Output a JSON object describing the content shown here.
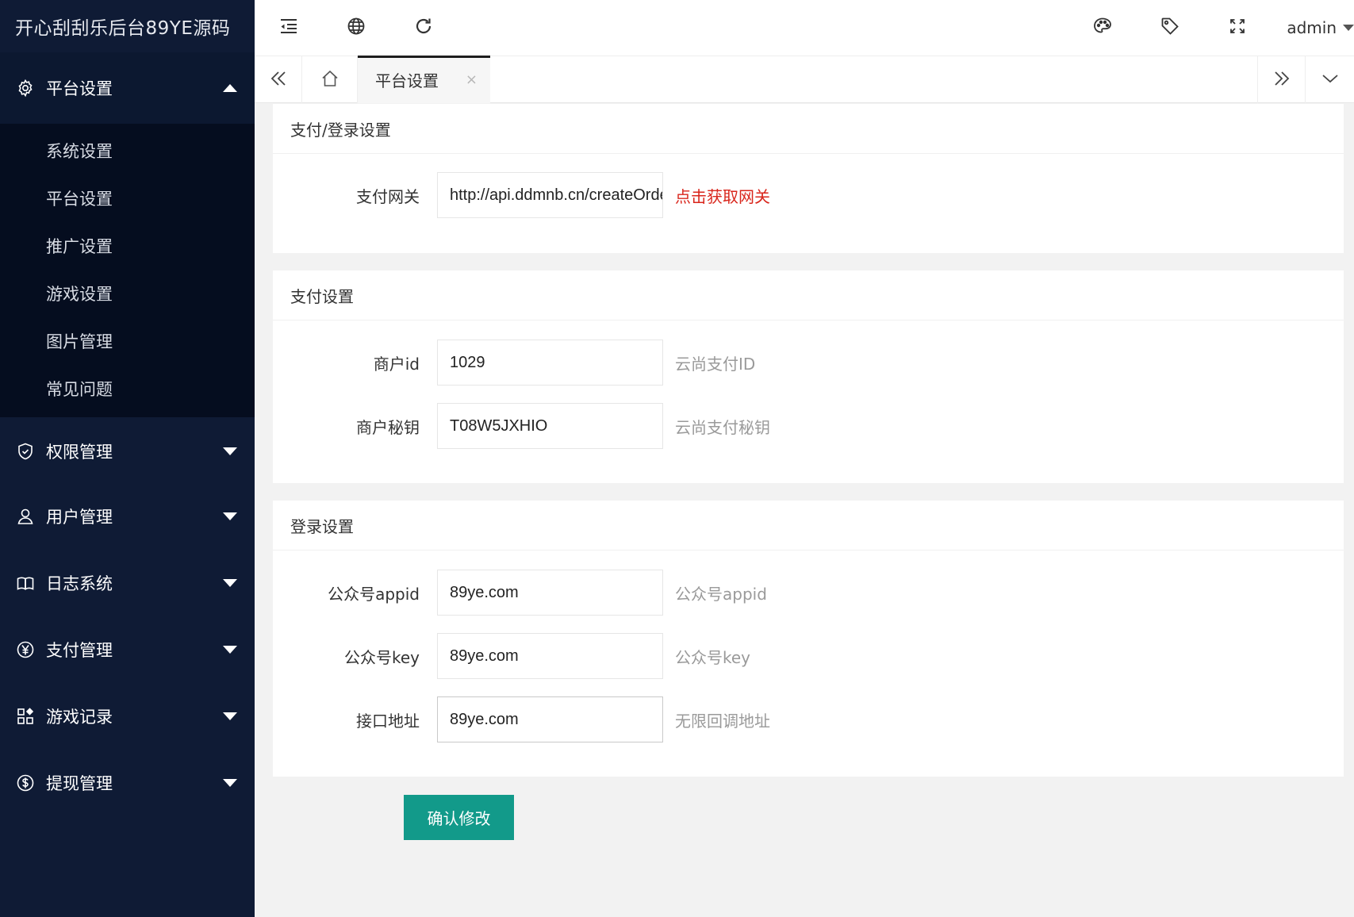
{
  "app": {
    "title": "开心刮刮乐后台89YE源码"
  },
  "sidebar": {
    "groups": [
      {
        "label": "平台设置",
        "icon": "gear-icon",
        "open": true,
        "items": [
          "系统设置",
          "平台设置",
          "推广设置",
          "游戏设置",
          "图片管理",
          "常见问题"
        ]
      },
      {
        "label": "权限管理",
        "icon": "shield-check-icon"
      },
      {
        "label": "用户管理",
        "icon": "user-icon"
      },
      {
        "label": "日志系统",
        "icon": "book-icon"
      },
      {
        "label": "支付管理",
        "icon": "yen-icon"
      },
      {
        "label": "游戏记录",
        "icon": "apps-icon"
      },
      {
        "label": "提现管理",
        "icon": "dollar-icon"
      }
    ]
  },
  "topbar": {
    "left_icons": [
      "menu-collapse-icon",
      "globe-icon",
      "refresh-icon"
    ],
    "right_icons": [
      "palette-icon",
      "tag-icon",
      "fullscreen-icon"
    ],
    "user": "admin"
  },
  "tabs": {
    "active_label": "平台设置",
    "close_glyph": "×"
  },
  "cards": {
    "gateway": {
      "title": "支付/登录设置",
      "label": "支付网关",
      "value": "http://api.ddmnb.cn/createOrder",
      "link": "点击获取网关"
    },
    "payment": {
      "title": "支付设置",
      "rows": [
        {
          "label": "商户id",
          "value": "1029",
          "hint": "云尚支付ID"
        },
        {
          "label": "商户秘钥",
          "value": "T08W5JXHIO",
          "hint": "云尚支付秘钥"
        }
      ]
    },
    "login": {
      "title": "登录设置",
      "rows": [
        {
          "label": "公众号appid",
          "value": "89ye.com",
          "hint": "公众号appid"
        },
        {
          "label": "公众号key",
          "value": "89ye.com",
          "hint": "公众号key"
        },
        {
          "label": "接口地址",
          "value": "89ye.com",
          "hint": "无限回调地址"
        }
      ]
    }
  },
  "submit": {
    "label": "确认修改"
  },
  "colors": {
    "sidebar_bg": "#0f1b35",
    "submenu_bg": "#050d1f",
    "primary": "#129a8a",
    "link_red": "#d9261c"
  }
}
